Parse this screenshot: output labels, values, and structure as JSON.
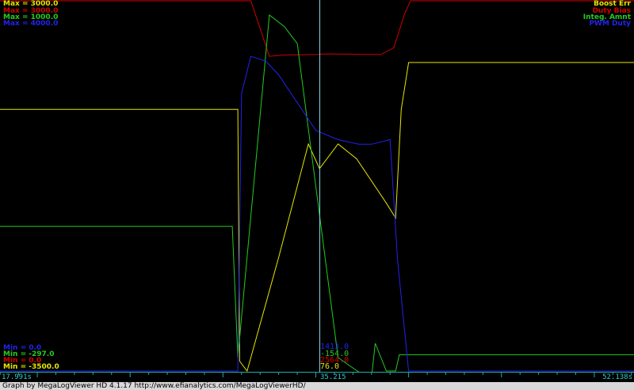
{
  "colors": {
    "boost_err": "#e6e600",
    "duty_bias": "#d00000",
    "integ_amnt": "#22cc22",
    "pwm_duty": "#2222ee",
    "cursor": "#7fd6e6",
    "axis": "#2aa"
  },
  "scale_labels": {
    "top": [
      "Max = 3000.0",
      "Max = 3000.0",
      "Max = 1000.0",
      "Max = 4000.0"
    ],
    "bottom": [
      "Min = 0.0",
      "Min = -297.0",
      "Min = 0.0",
      "Min = -3500.0"
    ]
  },
  "legend": [
    "Boost Err",
    "Duty Bias",
    "Integ. Amnt",
    "PWM Duty"
  ],
  "cursor_values": [
    "1413.0",
    "-154.0",
    "2564.0",
    "76.0"
  ],
  "axis": {
    "start": "17.991s",
    "cursor": "35.215",
    "end": "52.138s"
  },
  "footer": "Graph by MegaLogViewer HD 4.1.17 http://www.efianalytics.com/MegaLogViewerHD/",
  "chart_data": {
    "type": "line",
    "xlabel": "",
    "xlim": [
      17.991,
      52.138
    ],
    "cursor_x": 35.215,
    "series": [
      {
        "name": "Boost Err",
        "ylim": [
          -3500,
          4000
        ],
        "x": [
          17.991,
          30.8,
          30.9,
          31.3,
          33.0,
          34.6,
          35.2,
          36.2,
          37.2,
          38.8,
          39.3,
          39.6,
          40.0,
          52.138
        ],
        "y": [
          1800,
          1800,
          -3300,
          -3500,
          -1200,
          1100,
          600,
          1100,
          800,
          -100,
          -400,
          1800,
          2750,
          2750
        ]
      },
      {
        "name": "Duty Bias",
        "ylim": [
          0,
          3000
        ],
        "x": [
          17.991,
          30.7,
          30.9,
          31.5,
          32.5,
          33.2,
          35.0,
          35.6,
          38.5,
          39.2,
          39.8,
          40.1,
          52.138
        ],
        "y": [
          3000,
          3000,
          3000,
          3000,
          2550,
          2560,
          2565,
          2570,
          2565,
          2620,
          2900,
          3000,
          3000
        ]
      },
      {
        "name": "Integ. Amnt",
        "ylim": [
          -297,
          1000
        ],
        "x": [
          17.991,
          30.5,
          30.8,
          32.5,
          33.3,
          34.0,
          36.2,
          37.3,
          38.0,
          38.2,
          38.8,
          39.3,
          39.5,
          40.3,
          52.138
        ],
        "y": [
          210,
          210,
          -250,
          950,
          910,
          850,
          -250,
          -300,
          -320,
          -200,
          -297,
          -297,
          -240,
          -240,
          -240
        ]
      },
      {
        "name": "PWM Duty",
        "ylim": [
          0,
          4000
        ],
        "x": [
          17.991,
          30.8,
          31.0,
          31.5,
          32.3,
          33.0,
          33.5,
          35.0,
          36.2,
          37.3,
          38.0,
          39.0,
          39.4,
          40.0,
          52.138
        ],
        "y": [
          0,
          0,
          3000,
          3400,
          3350,
          3200,
          3050,
          2600,
          2500,
          2450,
          2450,
          2500,
          1200,
          0,
          0
        ]
      }
    ]
  }
}
